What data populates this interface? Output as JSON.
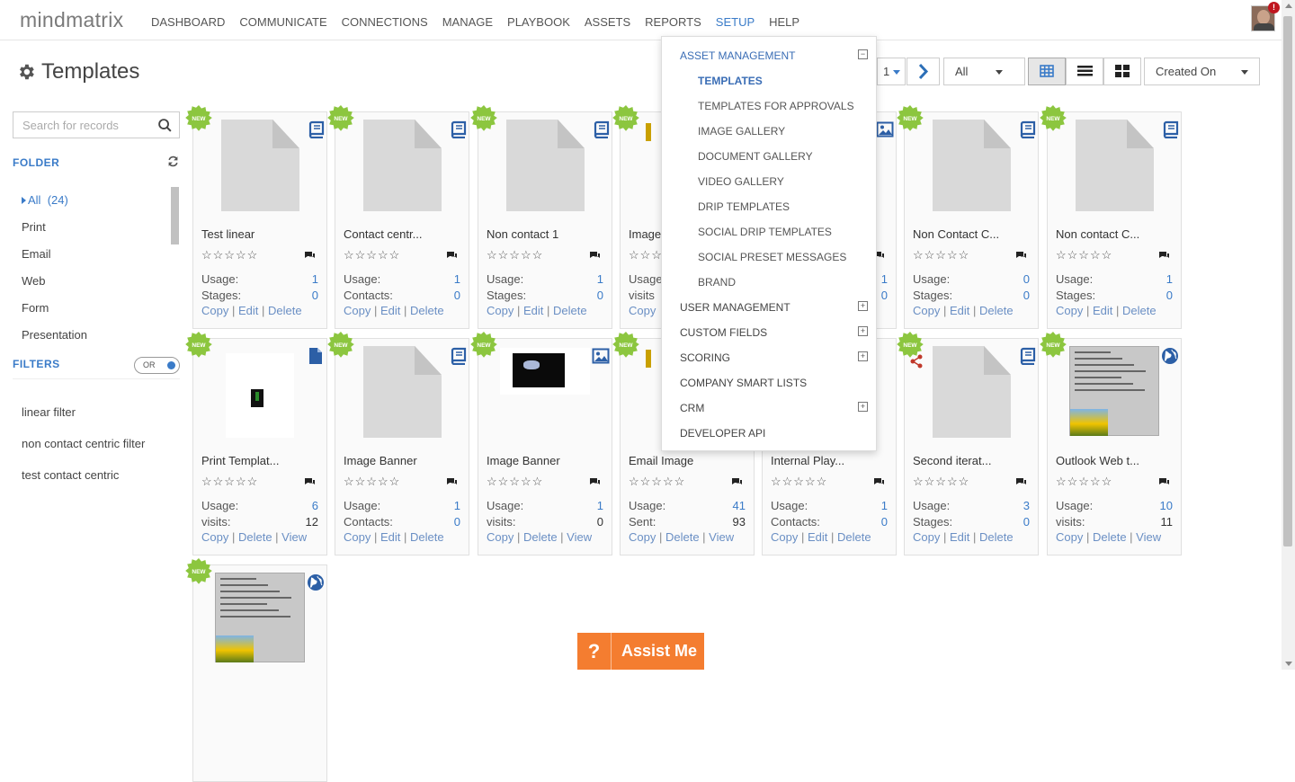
{
  "app": {
    "logo": "mindmatrix",
    "notification_count": "!"
  },
  "nav": [
    "DASHBOARD",
    "COMMUNICATE",
    "CONNECTIONS",
    "MANAGE",
    "PLAYBOOK",
    "ASSETS",
    "REPORTS",
    "SETUP",
    "HELP"
  ],
  "nav_active": "SETUP",
  "page": {
    "title": "Templates"
  },
  "search": {
    "placeholder": "Search for records",
    "value": ""
  },
  "sidebar": {
    "folder_heading": "FOLDER",
    "folders": [
      {
        "label": "All",
        "count": "(24)"
      },
      {
        "label": "Print"
      },
      {
        "label": "Email"
      },
      {
        "label": "Web"
      },
      {
        "label": "Form"
      },
      {
        "label": "Presentation"
      }
    ],
    "filters_heading": "FILTERS",
    "toggle_label": "OR",
    "filters": [
      "linear filter",
      "non contact centric filter",
      "test contact centric"
    ]
  },
  "toolbar": {
    "page": "1",
    "type_filter": "All",
    "sort": "Created On"
  },
  "cards": [
    {
      "name": "Test linear",
      "type": "book",
      "s1": "Usage:",
      "v1": "1",
      "s2": "Stages:",
      "v2": "0",
      "actions": [
        "Copy",
        "Edit",
        "Delete"
      ]
    },
    {
      "name": "Contact centr...",
      "type": "book",
      "s1": "Usage:",
      "v1": "1",
      "s2": "Contacts:",
      "v2": "0",
      "actions": [
        "Copy",
        "Edit",
        "Delete"
      ]
    },
    {
      "name": "Non contact 1",
      "type": "book",
      "s1": "Usage:",
      "v1": "1",
      "s2": "Stages:",
      "v2": "0",
      "actions": [
        "Copy",
        "Edit",
        "Delete"
      ]
    },
    {
      "name": "Image",
      "type": "image",
      "s1": "Usage",
      "v1": "",
      "s2": "visits",
      "v2": "",
      "actions": [
        "Copy"
      ]
    },
    {
      "name": "",
      "type": "image",
      "s1": "",
      "v1": "1",
      "s2": "",
      "v2": "0",
      "actions": []
    },
    {
      "name": "Non Contact C...",
      "type": "book",
      "s1": "Usage:",
      "v1": "0",
      "s2": "Stages:",
      "v2": "0",
      "actions": [
        "Copy",
        "Edit",
        "Delete"
      ]
    },
    {
      "name": "Non contact C...",
      "type": "book",
      "s1": "Usage:",
      "v1": "1",
      "s2": "Stages:",
      "v2": "0",
      "actions": [
        "Copy",
        "Edit",
        "Delete"
      ]
    },
    {
      "name": "Print Templat...",
      "type": "file",
      "s1": "Usage:",
      "v1": "6",
      "s2": "visits:",
      "v2": "12",
      "actions": [
        "Copy",
        "Delete",
        "View"
      ]
    },
    {
      "name": "Image Banner",
      "type": "book",
      "s1": "Usage:",
      "v1": "1",
      "s2": "Contacts:",
      "v2": "0",
      "actions": [
        "Copy",
        "Edit",
        "Delete"
      ]
    },
    {
      "name": "Image Banner",
      "type": "image",
      "s1": "Usage:",
      "v1": "1",
      "s2": "visits:",
      "v2": "0",
      "actions": [
        "Copy",
        "Delete",
        "View"
      ]
    },
    {
      "name": "Email Image",
      "type": "none",
      "s1": "Usage:",
      "v1": "41",
      "s2": "Sent:",
      "v2": "93",
      "actions": [
        "Copy",
        "Delete",
        "View"
      ]
    },
    {
      "name": "Internal Play...",
      "type": "none",
      "s1": "Usage:",
      "v1": "1",
      "s2": "Contacts:",
      "v2": "0",
      "actions": [
        "Copy",
        "Edit",
        "Delete"
      ]
    },
    {
      "name": "Second iterat...",
      "type": "book",
      "s1": "Usage:",
      "v1": "3",
      "s2": "Stages:",
      "v2": "0",
      "actions": [
        "Copy",
        "Edit",
        "Delete"
      ]
    },
    {
      "name": "Outlook Web t...",
      "type": "globe",
      "s1": "Usage:",
      "v1": "10",
      "s2": "visits:",
      "v2": "11",
      "actions": [
        "Copy",
        "Delete",
        "View"
      ]
    },
    {
      "name": "",
      "type": "globe",
      "s1": "",
      "v1": "",
      "s2": "",
      "v2": "",
      "actions": []
    }
  ],
  "badge_text": "NEW",
  "stars": "☆☆☆☆☆",
  "dropdown": {
    "asset_management": "ASSET MANAGEMENT",
    "asset_items": [
      "TEMPLATES",
      "TEMPLATES FOR APPROVALS",
      "IMAGE GALLERY",
      "DOCUMENT GALLERY",
      "VIDEO GALLERY",
      "DRIP TEMPLATES",
      "SOCIAL DRIP TEMPLATES",
      "SOCIAL PRESET MESSAGES",
      "BRAND"
    ],
    "selected_item": "TEMPLATES",
    "sections": [
      "USER MANAGEMENT",
      "CUSTOM FIELDS",
      "SCORING",
      "COMPANY SMART LISTS",
      "CRM",
      "DEVELOPER API"
    ]
  },
  "assist": {
    "icon": "?",
    "label": "Assist Me"
  },
  "colors": {
    "accent": "#3a7bc8",
    "badge": "#8cc63f",
    "assist": "#f47d30"
  }
}
